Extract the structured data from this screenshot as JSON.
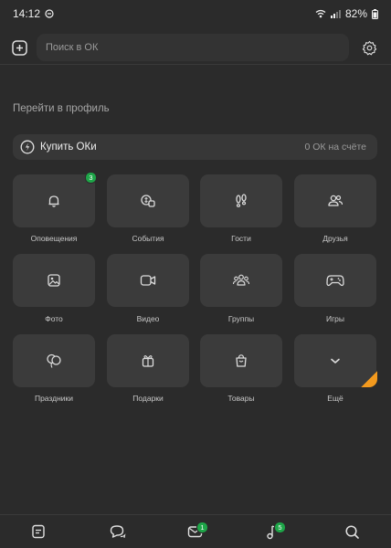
{
  "status_bar": {
    "time": "14:12",
    "battery": "82%"
  },
  "top_bar": {
    "search_placeholder": "Поиск в ОК"
  },
  "profile": {
    "link_text": "Перейти в профиль"
  },
  "oki": {
    "buy_label": "Купить ОКи",
    "balance": "0 ОК на счёте"
  },
  "grid": [
    {
      "label": "Оповещения",
      "icon": "bell-icon",
      "badge": "3"
    },
    {
      "label": "События",
      "icon": "events-icon"
    },
    {
      "label": "Гости",
      "icon": "footprints-icon"
    },
    {
      "label": "Друзья",
      "icon": "friends-icon"
    },
    {
      "label": "Фото",
      "icon": "photo-icon"
    },
    {
      "label": "Видео",
      "icon": "video-icon"
    },
    {
      "label": "Группы",
      "icon": "groups-icon"
    },
    {
      "label": "Игры",
      "icon": "gamepad-icon"
    },
    {
      "label": "Праздники",
      "icon": "balloons-icon"
    },
    {
      "label": "Подарки",
      "icon": "gift-icon"
    },
    {
      "label": "Товары",
      "icon": "shopping-bag-icon"
    },
    {
      "label": "Ещё",
      "icon": "chevron-down-icon"
    }
  ],
  "bottom_nav": [
    {
      "icon": "feed-icon"
    },
    {
      "icon": "chats-icon"
    },
    {
      "icon": "mail-icon",
      "badge": "1"
    },
    {
      "icon": "music-icon",
      "badge": "5"
    },
    {
      "icon": "search-icon"
    }
  ],
  "colors": {
    "background": "#2b2b2b",
    "tile": "#3b3b3b",
    "badge": "#1ea548",
    "accent_corner": "#f39a1e"
  }
}
